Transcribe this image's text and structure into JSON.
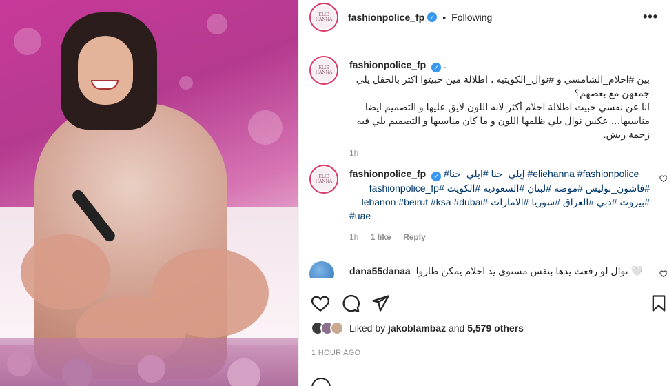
{
  "post": {
    "username": "fashionpolice_fp",
    "verified_mark": "✓",
    "separator": "•",
    "follow_status": "Following",
    "avatar_text": "ELIE HANNA",
    "more_icon": "•••"
  },
  "caption": {
    "username": "fashionpolice_fp",
    "after_name": ".",
    "line1": "بين #احلام_الشامسي و #نوال_الكويتيه ، اطلالة مين حبيتوا اكثر بالحفل يلي جمعهن مع بعضهم؟",
    "line2": "انا عن نفسي حبيت اطلالة احلام أكثر لانه اللون لايق عليها و التصميم ايضا مناسبها… عكس نوال يلي ظلمها اللون و ما كان مناسبها و التصميم يلي فيه زحمة ريش.",
    "time": "1h"
  },
  "comment1": {
    "username": "fashionpolice_fp",
    "tags_line1": "#إيلي_حنا #ايلي_حنا #eliehanna #fashionpolice",
    "tags_line2": "#فاشون_بوليس #موضة #لبنان #السعودية #الكويت #fashionpolice_fp",
    "tags_line3": "#بيروت #دبي #العراق #سوريا #الامارات #lebanon #beirut #ksa #dubai",
    "tags_line4": "#uae",
    "time": "1h",
    "likes": "1 like",
    "reply": "Reply"
  },
  "comment2": {
    "username": "dana55danaa",
    "text": "نوال لو رفعت يدها بنفس مستوى يد احلام يمكن طاروا 🤍"
  },
  "likes": {
    "prefix": "Liked by",
    "user": "jakoblambaz",
    "middle": "and",
    "others": "5,579 others"
  },
  "timestamp": "1 HOUR AGO",
  "colors": {
    "link": "#00376b",
    "verified": "#3897f0",
    "muted": "#8e8e8e",
    "text": "#262626"
  }
}
